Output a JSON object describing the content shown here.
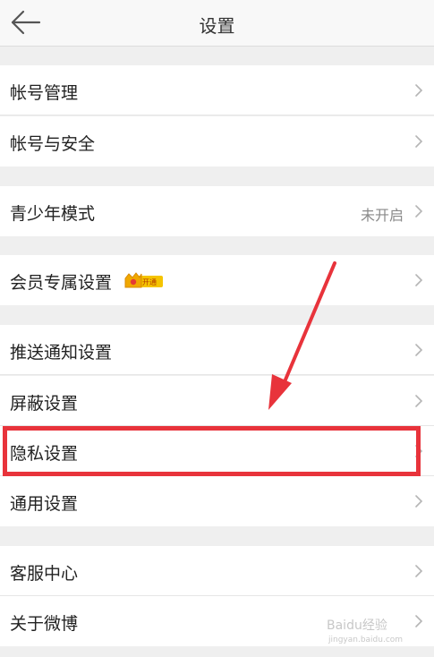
{
  "header": {
    "title": "设置",
    "back_icon": "back-arrow-icon"
  },
  "rows": [
    {
      "label": "帐号管理"
    },
    {
      "label": "帐号与安全"
    },
    {
      "label": "青少年模式",
      "value": "未开启"
    },
    {
      "label": "会员专属设置",
      "badge_text": "开通"
    },
    {
      "label": "推送通知设置"
    },
    {
      "label": "屏蔽设置"
    },
    {
      "label": "隐私设置"
    },
    {
      "label": "通用设置"
    },
    {
      "label": "客服中心"
    },
    {
      "label": "关于微博"
    }
  ],
  "annotation": {
    "highlight_color": "#e8333b",
    "highlighted_item": "隐私设置"
  },
  "watermark": {
    "brand": "Baidu经验",
    "url": "jingyan.baidu.com"
  },
  "colors": {
    "background": "#efefef",
    "row": "#ffffff",
    "text": "#222222",
    "secondary_text": "#8a8a8a",
    "chevron": "#b5b5b5",
    "badge": "#f5c400"
  }
}
